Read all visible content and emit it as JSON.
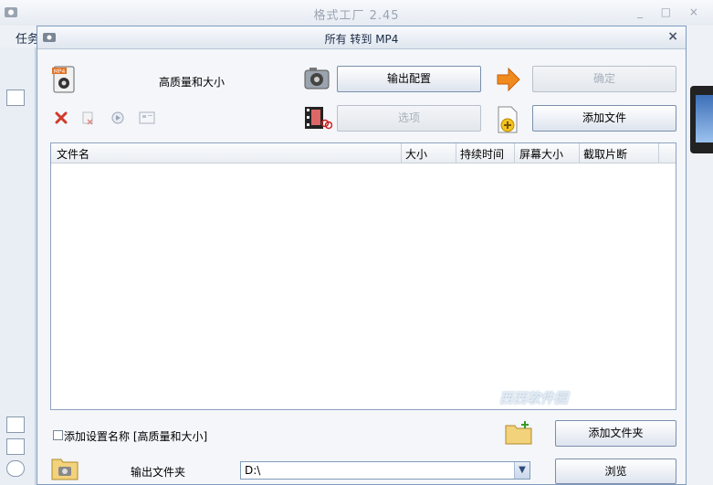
{
  "app": {
    "title": "格式工厂 2.45",
    "menu_label": "任务",
    "win_controls": "_ □ ×"
  },
  "dialog": {
    "title": "所有 转到 MP4",
    "close": "×",
    "preset_label": "高质量和大小",
    "buttons": {
      "output_config": "输出配置",
      "ok": "确定",
      "options": "选项",
      "add_file": "添加文件",
      "add_folder": "添加文件夹",
      "browse": "浏览"
    },
    "table": {
      "columns": [
        "文件名",
        "大小",
        "持续时间",
        "屏幕大小",
        "截取片断"
      ],
      "rows": []
    },
    "add_setting_name_label": "添加设置名称 [高质量和大小]",
    "output_folder_label": "输出文件夹",
    "output_folder_value": "D:\\"
  },
  "watermark": "西西软件园",
  "colors": {
    "accent": "#f08a1c",
    "delete_red": "#d23a2a",
    "border_blue": "#7f9bc0"
  }
}
